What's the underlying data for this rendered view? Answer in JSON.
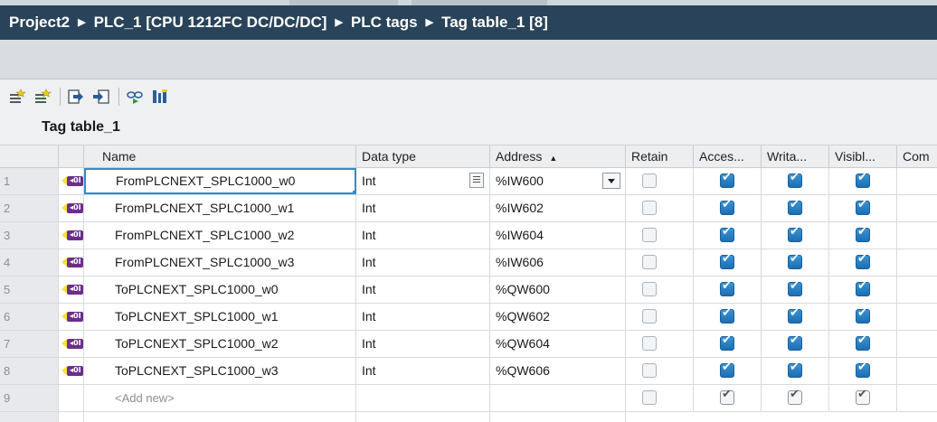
{
  "breadcrumb": [
    "Project2",
    "PLC_1 [CPU 1212FC DC/DC/DC]",
    "PLC tags",
    "Tag table_1 [8]"
  ],
  "table_title": "Tag table_1",
  "toolbar_icons": [
    "add-tag-icon",
    "insert-row-icon",
    "export-icon",
    "import-icon",
    "monitor-icon",
    "show-all-icon"
  ],
  "columns": {
    "name": "Name",
    "data_type": "Data type",
    "address": "Address",
    "retain": "Retain",
    "accessible": "Acces...",
    "writable": "Writa...",
    "visible": "Visibl...",
    "comment": "Com"
  },
  "sort_indicator": "▲",
  "rows": [
    {
      "num": "1",
      "name": "FromPLCNEXT_SPLC1000_w0",
      "type": "Int",
      "address": "%IW600",
      "retain": false,
      "access": true,
      "write": true,
      "visible": true
    },
    {
      "num": "2",
      "name": "FromPLCNEXT_SPLC1000_w1",
      "type": "Int",
      "address": "%IW602",
      "retain": false,
      "access": true,
      "write": true,
      "visible": true
    },
    {
      "num": "3",
      "name": "FromPLCNEXT_SPLC1000_w2",
      "type": "Int",
      "address": "%IW604",
      "retain": false,
      "access": true,
      "write": true,
      "visible": true
    },
    {
      "num": "4",
      "name": "FromPLCNEXT_SPLC1000_w3",
      "type": "Int",
      "address": "%IW606",
      "retain": false,
      "access": true,
      "write": true,
      "visible": true
    },
    {
      "num": "5",
      "name": "ToPLCNEXT_SPLC1000_w0",
      "type": "Int",
      "address": "%QW600",
      "retain": false,
      "access": true,
      "write": true,
      "visible": true
    },
    {
      "num": "6",
      "name": "ToPLCNEXT_SPLC1000_w1",
      "type": "Int",
      "address": "%QW602",
      "retain": false,
      "access": true,
      "write": true,
      "visible": true
    },
    {
      "num": "7",
      "name": "ToPLCNEXT_SPLC1000_w2",
      "type": "Int",
      "address": "%QW604",
      "retain": false,
      "access": true,
      "write": true,
      "visible": true
    },
    {
      "num": "8",
      "name": "ToPLCNEXT_SPLC1000_w3",
      "type": "Int",
      "address": "%QW606",
      "retain": false,
      "access": true,
      "write": true,
      "visible": true
    }
  ],
  "add_row": {
    "num": "9",
    "label": "<Add new>"
  },
  "tag_icon_label": "◂0I",
  "colors": {
    "title_bar": "#29445a",
    "checkbox_on": "#1c6eb3",
    "tag_icon": "#6c2d8c",
    "selection": "#2d8cd0"
  }
}
